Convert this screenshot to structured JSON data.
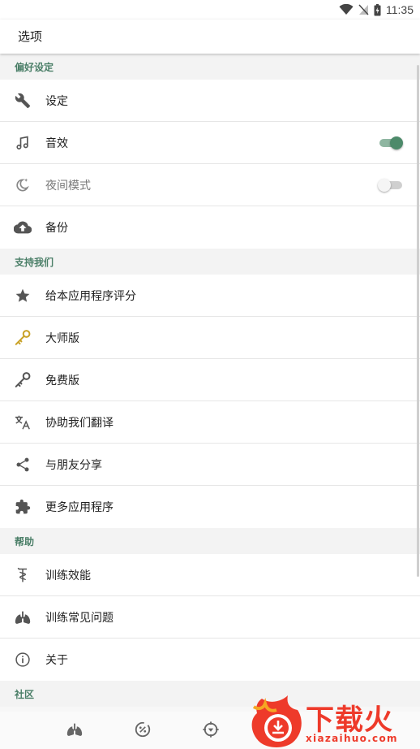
{
  "status_bar": {
    "time": "11:35",
    "icons": [
      "wifi-icon",
      "no-signal-icon",
      "battery-icon"
    ]
  },
  "app_bar": {
    "title": "选项"
  },
  "sections": {
    "preferences": {
      "title": "偏好设定",
      "items": [
        {
          "label": "设定",
          "icon": "wrench-icon"
        },
        {
          "label": "音效",
          "icon": "music-note-icon",
          "toggle": true
        },
        {
          "label": "夜间模式",
          "icon": "moon-icon",
          "toggle": false
        },
        {
          "label": "备份",
          "icon": "cloud-upload-icon"
        }
      ]
    },
    "support": {
      "title": "支持我们",
      "items": [
        {
          "label": "给本应用程序评分",
          "icon": "star-icon"
        },
        {
          "label": "大师版",
          "icon": "gold-key-icon"
        },
        {
          "label": "免费版",
          "icon": "key-icon"
        },
        {
          "label": "协助我们翻译",
          "icon": "translate-icon"
        },
        {
          "label": "与朋友分享",
          "icon": "share-icon"
        },
        {
          "label": "更多应用程序",
          "icon": "puzzle-icon"
        }
      ]
    },
    "help": {
      "title": "帮助",
      "items": [
        {
          "label": "训练效能",
          "icon": "caduceus-icon"
        },
        {
          "label": "训练常见问题",
          "icon": "lungs-icon"
        },
        {
          "label": "关于",
          "icon": "info-icon"
        }
      ]
    },
    "community": {
      "title": "社区"
    }
  },
  "bottom_nav": {
    "icons": [
      "lungs-icon",
      "percent-icon",
      "target-icon"
    ]
  },
  "watermark": {
    "title": "下载火",
    "url": "xiazaihuo.com"
  },
  "colors": {
    "accent": "#4d8a6a",
    "section_header": "#4b7f68",
    "watermark": "#ee3a2a",
    "gold_key": "#c9a227"
  }
}
